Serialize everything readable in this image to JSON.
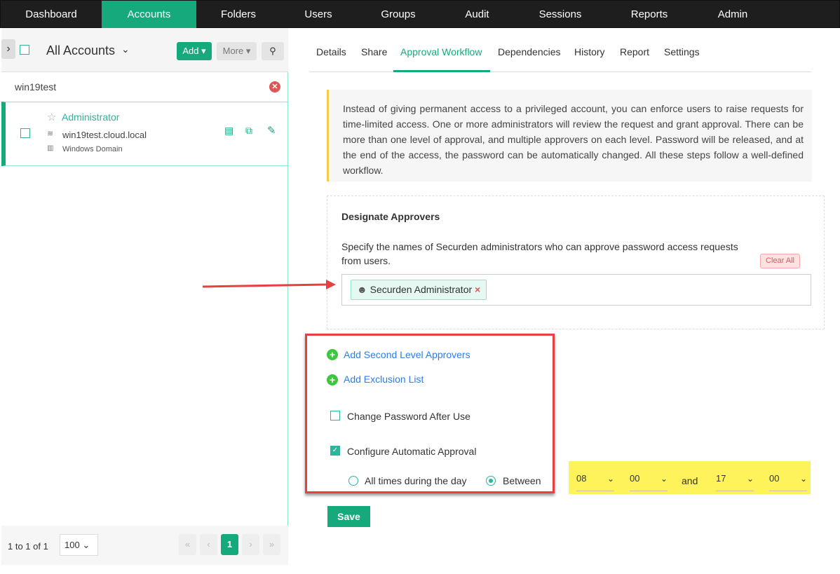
{
  "nav": [
    "Dashboard",
    "Accounts",
    "Folders",
    "Users",
    "Groups",
    "Audit",
    "Sessions",
    "Reports",
    "Admin"
  ],
  "left": {
    "title": "All Accounts",
    "add": "Add",
    "more": "More",
    "search_value": "win19test",
    "account": {
      "name": "Administrator",
      "host": "win19test.cloud.local",
      "type": "Windows Domain"
    },
    "footer": {
      "range": "1 to 1 of 1",
      "page_size": "100",
      "current_page": "1"
    }
  },
  "tabs": [
    "Details",
    "Share",
    "Approval Workflow",
    "Dependencies",
    "History",
    "Report",
    "Settings"
  ],
  "info": "Instead of giving permanent access to a privileged account, you can enforce users to raise requests for time-limited access. One or more administrators will review the request and grant approval. There can be more than one level of approval, and multiple approvers on each level. Password will be released, and at the end of the access, the password can be automatically changed. All these steps follow a well-defined workflow.",
  "approvers": {
    "title": "Designate Approvers",
    "desc": "Specify the names of Securden administrators who can approve password access requests from users.",
    "clear": "Clear All",
    "chip": "Securden Administrator"
  },
  "options": {
    "second_level": "Add Second Level Approvers",
    "exclusion": "Add Exclusion List",
    "change_pw": "Change Password After Use",
    "change_pw_checked": false,
    "auto_approval": "Configure Automatic Approval",
    "auto_approval_checked": true,
    "all_times": "All times during the day",
    "between": "Between",
    "selected": "Between"
  },
  "time": {
    "from_h": "08",
    "from_m": "00",
    "and": "and",
    "to_h": "17",
    "to_m": "00"
  },
  "save": "Save",
  "colors": {
    "accent": "#16a97c",
    "highlight": "#fff35c",
    "annotation": "#e84040"
  }
}
